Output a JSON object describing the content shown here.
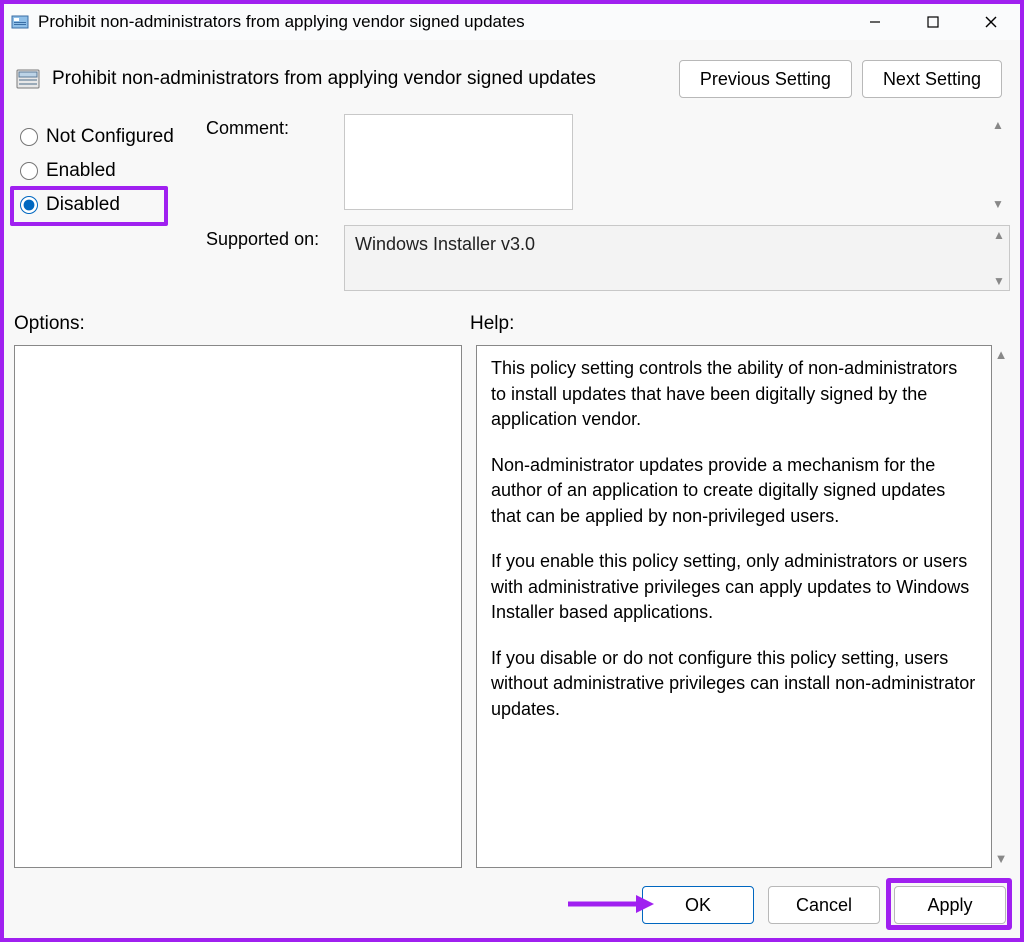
{
  "window": {
    "title": "Prohibit non-administrators from applying vendor signed updates"
  },
  "header": {
    "setting_name": "Prohibit non-administrators from applying vendor signed updates",
    "prev_btn": "Previous Setting",
    "next_btn": "Next Setting"
  },
  "state_radios": {
    "not_configured": "Not Configured",
    "enabled": "Enabled",
    "disabled": "Disabled",
    "selected": "disabled"
  },
  "form": {
    "comment_label": "Comment:",
    "comment_value": "",
    "supported_label": "Supported on:",
    "supported_value": "Windows Installer v3.0"
  },
  "panels": {
    "options_label": "Options:",
    "help_label": "Help:",
    "help_paragraphs": [
      "This policy setting controls the ability of non-administrators to install updates that have been digitally signed by the application vendor.",
      "Non-administrator updates provide a mechanism for the author of an application to create digitally signed updates that can be applied by non-privileged users.",
      "If you enable this policy setting, only administrators or users with administrative privileges can apply updates to Windows Installer based applications.",
      "If you disable or do not configure this policy setting, users without administrative privileges can install non-administrator updates."
    ]
  },
  "buttons": {
    "ok": "OK",
    "cancel": "Cancel",
    "apply": "Apply"
  },
  "annotation": {
    "highlight_disabled": true,
    "highlight_apply": true,
    "arrow_to_ok": true
  },
  "colors": {
    "accent": "#0067c0",
    "annotation": "#a020f0"
  }
}
